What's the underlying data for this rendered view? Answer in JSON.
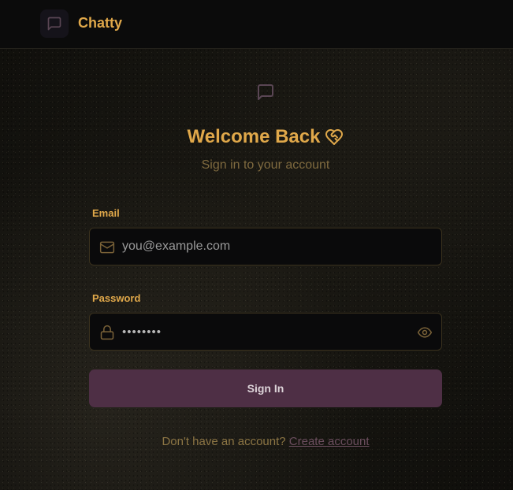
{
  "header": {
    "app_title": "Chatty",
    "logo_icon": "message-square-icon"
  },
  "login": {
    "icon": "message-square-icon",
    "title": "Welcome Back",
    "title_icon": "hand-heart-icon",
    "subtitle": "Sign in to your account",
    "email": {
      "label": "Email",
      "placeholder": "you@example.com",
      "icon": "mail-icon"
    },
    "password": {
      "label": "Password",
      "value": "••••••••",
      "icon": "lock-icon",
      "toggle_icon": "eye-icon"
    },
    "submit_label": "Sign In",
    "footer_text": "Don't have an account?",
    "footer_link": "Create account"
  },
  "colors": {
    "accent": "#e0a84a",
    "button_bg": "#4e2f45",
    "background": "#13120e",
    "link": "#6b4e5e"
  }
}
